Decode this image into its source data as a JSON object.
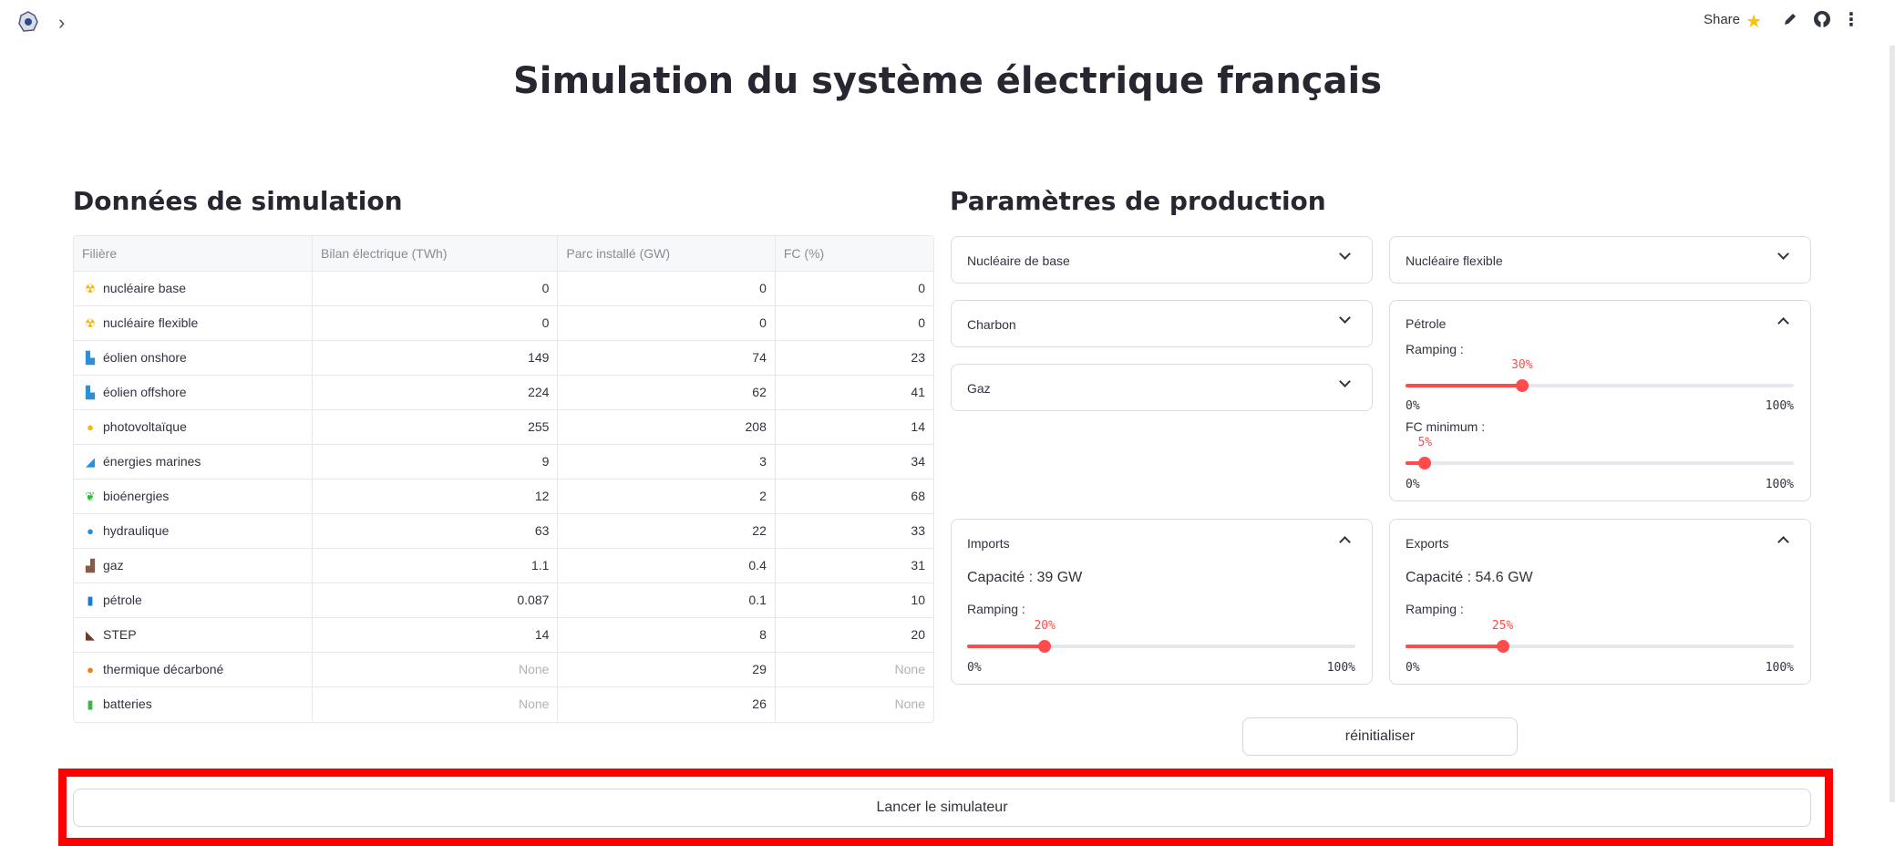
{
  "topbar": {
    "share_label": "Share",
    "icons": [
      "app-logo-icon",
      "chevron-right-icon",
      "star-icon",
      "pencil-icon",
      "github-icon",
      "more-vertical-icon"
    ]
  },
  "page_title": "Simulation du système électrique français",
  "left": {
    "section_title": "Données de simulation",
    "table": {
      "headers": [
        "Filière",
        "Bilan électrique (TWh)",
        "Parc installé (GW)",
        "FC (%)"
      ],
      "rows": [
        {
          "icon": "radioactive-icon",
          "glyph": "☢",
          "color": "#f2b200",
          "name": "nucléaire base",
          "bilan": "0",
          "parc": "0",
          "fc": "0"
        },
        {
          "icon": "radioactive-icon",
          "glyph": "☢",
          "color": "#f2b200",
          "name": "nucléaire flexible",
          "bilan": "0",
          "parc": "0",
          "fc": "0"
        },
        {
          "icon": "wind-turbine-icon",
          "glyph": "▙",
          "color": "#2d8fd8",
          "name": "éolien onshore",
          "bilan": "149",
          "parc": "74",
          "fc": "23"
        },
        {
          "icon": "wind-turbine-icon",
          "glyph": "▙",
          "color": "#2d8fd8",
          "name": "éolien offshore",
          "bilan": "224",
          "parc": "62",
          "fc": "41"
        },
        {
          "icon": "sun-icon",
          "glyph": "●",
          "color": "#ffb400",
          "name": "photovoltaïque",
          "bilan": "255",
          "parc": "208",
          "fc": "14"
        },
        {
          "icon": "wave-icon",
          "glyph": "◢",
          "color": "#1e90e0",
          "name": "énergies marines",
          "bilan": "9",
          "parc": "3",
          "fc": "34"
        },
        {
          "icon": "leaf-icon",
          "glyph": "❦",
          "color": "#2eb83a",
          "name": "bioénergies",
          "bilan": "12",
          "parc": "2",
          "fc": "68"
        },
        {
          "icon": "droplet-icon",
          "glyph": "●",
          "color": "#1e90e0",
          "name": "hydraulique",
          "bilan": "63",
          "parc": "22",
          "fc": "33"
        },
        {
          "icon": "factory-icon",
          "glyph": "▟",
          "color": "#8a5a44",
          "name": "gaz",
          "bilan": "1.1",
          "parc": "0.4",
          "fc": "31"
        },
        {
          "icon": "oil-barrel-icon",
          "glyph": "▮",
          "color": "#1e78d8",
          "name": "pétrole",
          "bilan": "0.087",
          "parc": "0.1",
          "fc": "10"
        },
        {
          "icon": "dam-icon",
          "glyph": "◣",
          "color": "#6b3b2a",
          "name": "STEP",
          "bilan": "14",
          "parc": "8",
          "fc": "20"
        },
        {
          "icon": "fire-icon",
          "glyph": "●",
          "color": "#ff7a00",
          "name": "thermique décarboné",
          "bilan": "None",
          "parc": "29",
          "fc": "None"
        },
        {
          "icon": "battery-icon",
          "glyph": "▮",
          "color": "#3cb84a",
          "name": "batteries",
          "bilan": "None",
          "parc": "26",
          "fc": "None"
        }
      ]
    }
  },
  "right": {
    "section_title": "Paramètres de production",
    "expanders": {
      "nuc_base": {
        "title": "Nucléaire de base"
      },
      "nuc_flex": {
        "title": "Nucléaire flexible"
      },
      "charbon": {
        "title": "Charbon"
      },
      "gaz": {
        "title": "Gaz"
      },
      "petrole": {
        "title": "Pétrole",
        "ramping_label": "Ramping :",
        "ramping_value": 30,
        "ramping_display": "30%",
        "fcmin_label": "FC minimum :",
        "fcmin_value": 5,
        "fcmin_display": "5%",
        "min": "0%",
        "max": "100%"
      },
      "imports": {
        "title": "Imports",
        "capacity": "Capacité : 39 GW",
        "ramping_label": "Ramping :",
        "ramping_value": 20,
        "ramping_display": "20%",
        "min": "0%",
        "max": "100%"
      },
      "exports": {
        "title": "Exports",
        "capacity": "Capacité : 54.6 GW",
        "ramping_label": "Ramping :",
        "ramping_value": 25,
        "ramping_display": "25%",
        "min": "0%",
        "max": "100%"
      }
    },
    "reset_label": "réinitialiser"
  },
  "launch_label": "Lancer le simulateur",
  "colors": {
    "accent": "#ff4b4b",
    "highlight": "#ff0000"
  }
}
